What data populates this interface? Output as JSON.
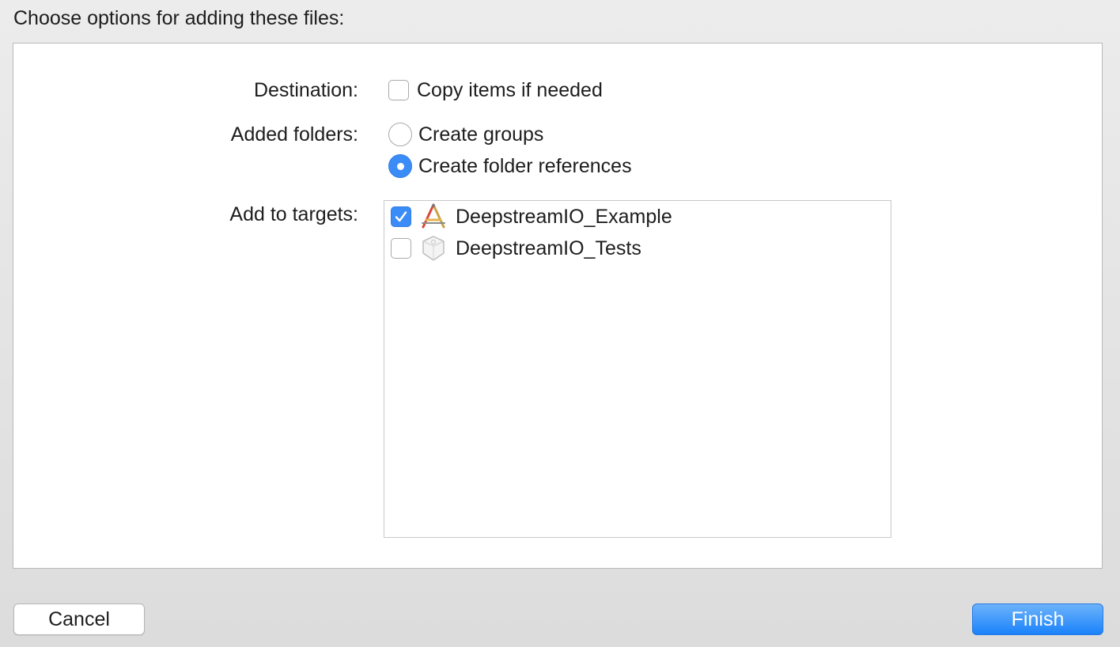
{
  "dialog": {
    "heading": "Choose options for adding these files:"
  },
  "destination": {
    "label": "Destination:",
    "option_label": "Copy items if needed",
    "checked": false
  },
  "added_folders": {
    "label": "Added folders:",
    "options": [
      {
        "label": "Create groups",
        "selected": false
      },
      {
        "label": "Create folder references",
        "selected": true
      }
    ]
  },
  "targets": {
    "label": "Add to targets:",
    "items": [
      {
        "name": "DeepstreamIO_Example",
        "checked": true,
        "icon": "app-target-icon"
      },
      {
        "name": "DeepstreamIO_Tests",
        "checked": false,
        "icon": "test-bundle-icon"
      }
    ]
  },
  "buttons": {
    "cancel": "Cancel",
    "finish": "Finish"
  },
  "colors": {
    "accent": "#3b8cf7",
    "finish_button": "#1a82fb"
  }
}
